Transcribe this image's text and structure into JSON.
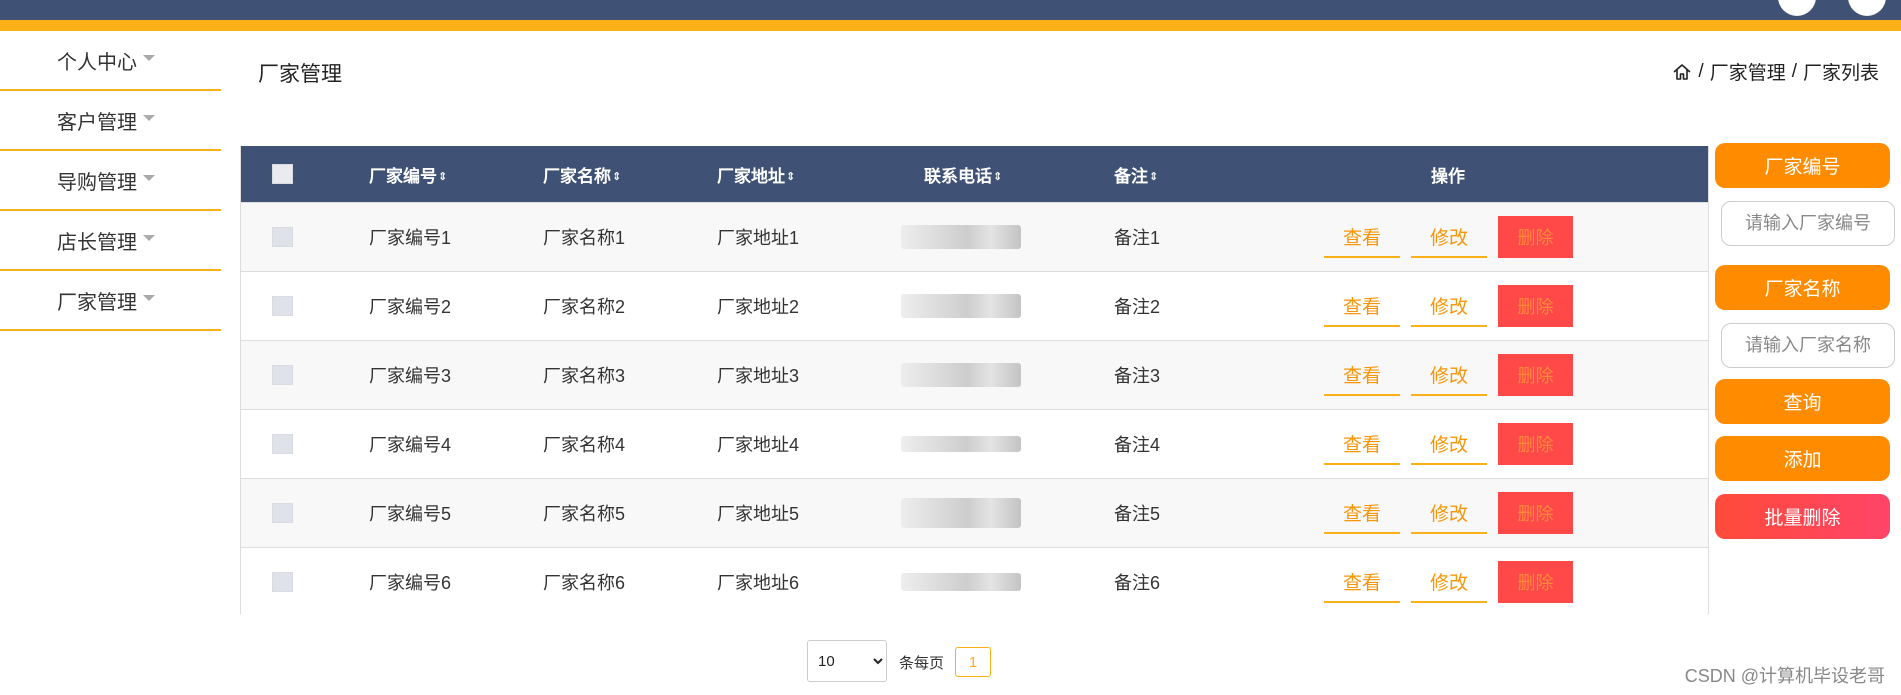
{
  "colors": {
    "nav_bg": "#3f5275",
    "accent": "#fbb018",
    "orange_btn": "#ff8c00",
    "danger": "#ff4848"
  },
  "sidebar": {
    "items": [
      {
        "label": "个人中心"
      },
      {
        "label": "客户管理"
      },
      {
        "label": "导购管理"
      },
      {
        "label": "店长管理"
      },
      {
        "label": "厂家管理"
      }
    ]
  },
  "header": {
    "title": "厂家管理",
    "breadcrumb": {
      "home_icon": "home-icon",
      "sep1": "/",
      "level1": "厂家管理",
      "sep2": "/",
      "level2": "厂家列表"
    }
  },
  "table": {
    "columns": {
      "code": "厂家编号",
      "name": "厂家名称",
      "address": "厂家地址",
      "phone": "联系电话",
      "note": "备注",
      "actions": "操作"
    },
    "sort_icon": "⇕",
    "rows": [
      {
        "code": "厂家编号1",
        "name": "厂家名称1",
        "address": "厂家地址1",
        "note": "备注1"
      },
      {
        "code": "厂家编号2",
        "name": "厂家名称2",
        "address": "厂家地址2",
        "note": "备注2"
      },
      {
        "code": "厂家编号3",
        "name": "厂家名称3",
        "address": "厂家地址3",
        "note": "备注3"
      },
      {
        "code": "厂家编号4",
        "name": "厂家名称4",
        "address": "厂家地址4",
        "note": "备注4"
      },
      {
        "code": "厂家编号5",
        "name": "厂家名称5",
        "address": "厂家地址5",
        "note": "备注5"
      },
      {
        "code": "厂家编号6",
        "name": "厂家名称6",
        "address": "厂家地址6",
        "note": "备注6"
      }
    ],
    "row_actions": {
      "view": "查看",
      "edit": "修改",
      "delete": "删除"
    }
  },
  "search_panel": {
    "code_label": "厂家编号",
    "code_placeholder": "请输入厂家编号",
    "name_label": "厂家名称",
    "name_placeholder": "请输入厂家名称",
    "query_button": "查询",
    "add_button": "添加",
    "batch_delete_button": "批量删除"
  },
  "pagination": {
    "page_size": "10",
    "per_page_label": "条每页",
    "current_page": "1"
  },
  "watermark": "CSDN @计算机毕设老哥"
}
